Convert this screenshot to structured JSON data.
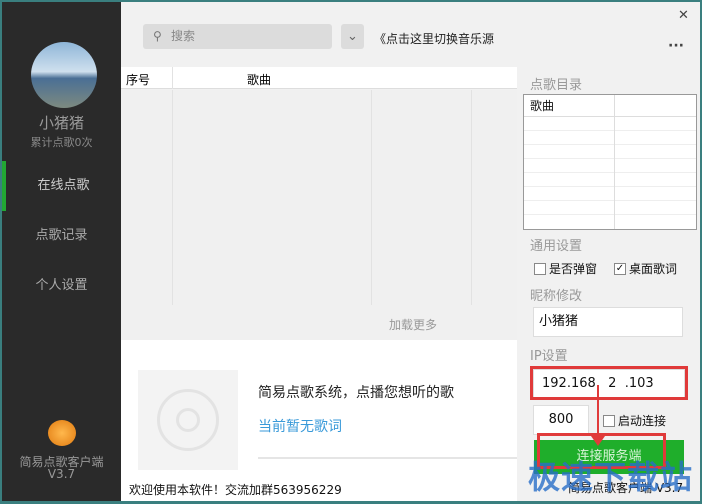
{
  "sidebar": {
    "username": "小猪猪",
    "play_count": "累计点歌0次",
    "items": [
      {
        "label": "在线点歌",
        "active": true
      },
      {
        "label": "点歌记录"
      },
      {
        "label": "个人设置"
      }
    ],
    "app_name": "简易点歌客户端",
    "version": "V3.7"
  },
  "header": {
    "search_placeholder": "搜索",
    "source_hint": "《点击这里切换音乐源",
    "close": "✕",
    "more": "···"
  },
  "list": {
    "columns": [
      "序号",
      "歌曲"
    ],
    "load_more": "加载更多"
  },
  "player": {
    "slogan": "简易点歌系统，点播您想听的歌",
    "lyric": "当前暂无歌词",
    "welcome": "欢迎使用本软件！交流加群563956229"
  },
  "right": {
    "catalog_label": "点歌目录",
    "catalog_column": "歌曲",
    "general_label": "通用设置",
    "popup_label": "是否弹窗",
    "popup_checked": false,
    "lyrics_label": "桌面歌词",
    "lyrics_checked": true,
    "nickname_label": "昵称修改",
    "nickname": "小猪猪",
    "ip_label": "IP设置",
    "ip": "192.168.  2  .103",
    "port": "800",
    "auto_connect_label": "启动连接",
    "auto_connect_checked": false,
    "connect_button": "连接服务端",
    "footer": "简易点歌客户端 V3.7"
  },
  "watermark": "极速下载站",
  "colors": {
    "accent": "#1fae2b",
    "link": "#3a9ad9",
    "highlight": "#e03a3a"
  }
}
